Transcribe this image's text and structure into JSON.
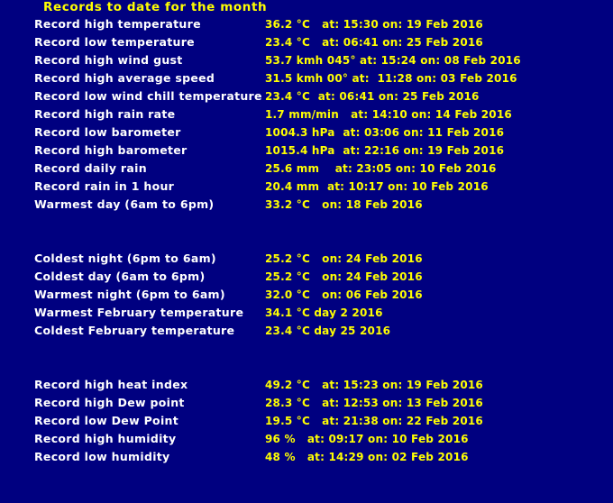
{
  "page": {
    "title": "Records to date for the month",
    "background_color": "#000080",
    "label_color": "#FFFFFF",
    "value_color": "#FFFF00"
  },
  "rows": [
    {
      "label": "Record high temperature",
      "value": "36.2 °C   at: 15:30 on: 19 Feb 2016"
    },
    {
      "label": "Record low temperature",
      "value": "23.4 °C   at: 06:41 on: 25 Feb 2016"
    },
    {
      "label": "Record high wind gust",
      "value": "53.7 kmh 045° at: 15:24 on: 08 Feb 2016"
    },
    {
      "label": "Record high average speed",
      "value": "31.5 kmh 00° at:  11:28 on: 03 Feb 2016"
    },
    {
      "label": "Record low wind chill temperature",
      "value": "23.4 °C  at: 06:41 on: 25 Feb 2016"
    },
    {
      "label": "Record high rain rate",
      "value": "1.7 mm/min   at: 14:10 on: 14 Feb 2016"
    },
    {
      "label": "Record low barometer",
      "value": "1004.3 hPa  at: 03:06 on: 11 Feb 2016"
    },
    {
      "label": "Record high barometer",
      "value": "1015.4 hPa  at: 22:16 on: 19 Feb 2016"
    },
    {
      "label": "Record daily rain",
      "value": "25.6 mm    at: 23:05 on: 10 Feb 2016"
    },
    {
      "label": "Record rain in 1 hour",
      "value": "20.4 mm  at: 10:17 on: 10 Feb 2016"
    },
    {
      "label": "Warmest day (6am to 6pm)",
      "value": "33.2 °C   on: 18 Feb 2016"
    },
    {
      "label": "",
      "value": "",
      "spacer": true
    },
    {
      "label": "",
      "value": "",
      "spacer": true
    },
    {
      "label": "Coldest night (6pm to 6am)",
      "value": "25.2 °C   on: 24 Feb 2016"
    },
    {
      "label": "Coldest day (6am to 6pm)",
      "value": "25.2 °C   on: 24 Feb 2016"
    },
    {
      "label": "Warmest night (6pm to 6am)",
      "value": "32.0 °C   on: 06 Feb 2016"
    },
    {
      "label": "Warmest February temperature",
      "value": "34.1 °C day 2 2016"
    },
    {
      "label": "Coldest February temperature",
      "value": "23.4 °C day 25 2016"
    },
    {
      "label": "",
      "value": "",
      "spacer": true
    },
    {
      "label": "",
      "value": "",
      "spacer": true
    },
    {
      "label": "Record high heat index",
      "value": "49.2 °C   at: 15:23 on: 19 Feb 2016"
    },
    {
      "label": "Record high Dew point",
      "value": "28.3 °C   at: 12:53 on: 13 Feb 2016"
    },
    {
      "label": "Record low Dew Point",
      "value": "19.5 °C   at: 21:38 on: 22 Feb 2016"
    },
    {
      "label": "Record high humidity",
      "value": "96 %   at: 09:17 on: 10 Feb 2016"
    },
    {
      "label": "Record low humidity",
      "value": "48 %   at: 14:29 on: 02 Feb 2016"
    }
  ]
}
